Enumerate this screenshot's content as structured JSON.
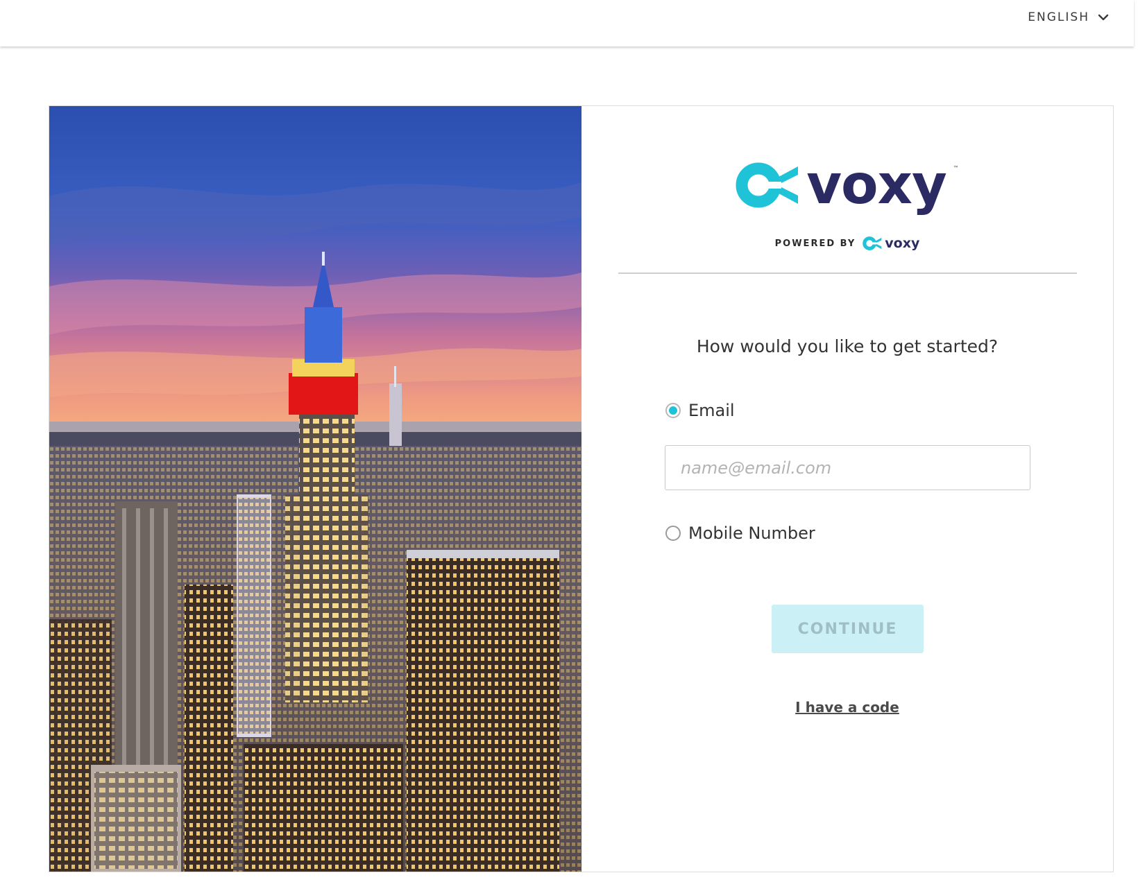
{
  "header": {
    "language_label": "ENGLISH"
  },
  "brand": {
    "logo_text": "voxy",
    "trademark": "™",
    "powered_by_label": "POWERED BY",
    "powered_by_logo_text": "voxy",
    "accent_color": "#1ec3d8",
    "wordmark_color": "#2b2a63"
  },
  "form": {
    "question": "How would you like to get started?",
    "options": [
      {
        "label": "Email",
        "selected": true
      },
      {
        "label": "Mobile Number",
        "selected": false
      }
    ],
    "email_placeholder": "name@email.com",
    "email_value": "",
    "continue_label": "CONTINUE",
    "continue_disabled": true,
    "code_link_label": "I have a code"
  },
  "hero_image": {
    "description_icon": "city-skyline-photo"
  }
}
